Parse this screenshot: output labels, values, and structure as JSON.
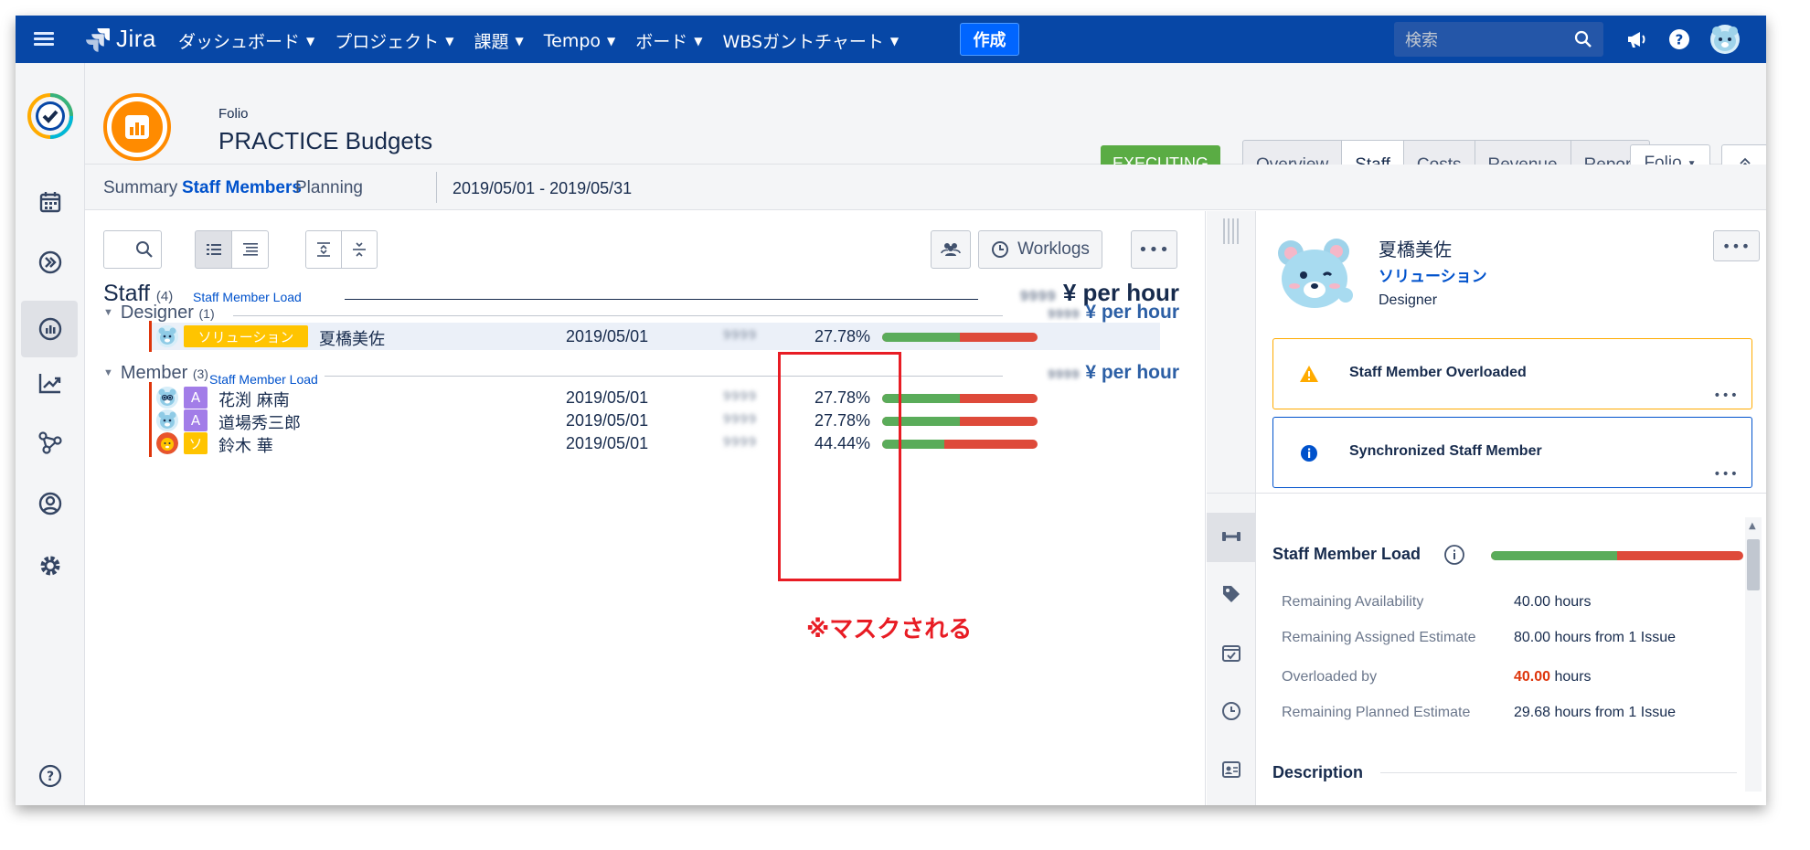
{
  "topnav": {
    "logo_text": "Jira",
    "menu": [
      {
        "label": "ダッシュボード",
        "has_dropdown": true
      },
      {
        "label": "プロジェクト",
        "has_dropdown": true
      },
      {
        "label": "課題",
        "has_dropdown": true
      },
      {
        "label": "Tempo",
        "has_dropdown": true
      },
      {
        "label": "ボード",
        "has_dropdown": true
      },
      {
        "label": "WBSガントチャート",
        "has_dropdown": true
      }
    ],
    "create_label": "作成",
    "search_placeholder": "検索",
    "icons": [
      "megaphone-icon",
      "help-icon",
      "user-avatar-icon"
    ],
    "colors": {
      "bar": "#0747a6",
      "create": "#0065ff"
    }
  },
  "sidebar": {
    "icons": [
      "app-logo-icon",
      "calendar-icon",
      "forward-icon",
      "dashboard-icon",
      "chart-icon",
      "network-icon",
      "user-circle-icon",
      "settings-icon",
      "help-icon"
    ],
    "active_index": 3
  },
  "project": {
    "parent": "Folio",
    "title": "PRACTICE Budgets",
    "status": "EXECUTING",
    "status_color": "#5aac44",
    "tabs": [
      {
        "label": "Overview",
        "active": false
      },
      {
        "label": "Staff",
        "active": true
      },
      {
        "label": "Costs",
        "active": false
      },
      {
        "label": "Revenue",
        "active": false
      },
      {
        "label": "Report",
        "active": false
      }
    ],
    "folio_dropdown": "Folio"
  },
  "subtabs": {
    "items": [
      "Summary",
      "Staff Members",
      "Planning"
    ],
    "active": "Staff Members",
    "date_range": "2019/05/01  - 2019/05/31"
  },
  "staff": {
    "title": "Staff",
    "count": "(4)",
    "load_link": "Staff Member Load",
    "rate_masked": "9999",
    "rate_unit": "¥ per hour",
    "worklogs_label": "Worklogs",
    "groups": [
      {
        "name": "Designer",
        "count": "(1)",
        "load_link": "",
        "rate_masked": "9999",
        "rate_unit": "¥ per hour",
        "members": [
          {
            "badge": "ソリューション",
            "badge_color": "#ffc400",
            "name": "夏橋美佐",
            "date": "2019/05/01",
            "masked": "9999",
            "pct": "27.78%",
            "fill": 0.5,
            "highlight": true,
            "avatar": "bear"
          }
        ]
      },
      {
        "name": "Member",
        "count": "(3)",
        "load_link": "Staff Member Load",
        "rate_masked": "9999",
        "rate_unit": "¥ per hour",
        "members": [
          {
            "badge": "A",
            "badge_color": "#a27de8",
            "name": "花渕 麻南",
            "date": "2019/05/01",
            "masked": "9999",
            "pct": "27.78%",
            "fill": 0.5,
            "highlight": false,
            "avatar": "bear-glasses"
          },
          {
            "badge": "A",
            "badge_color": "#a27de8",
            "name": "道場秀三郎",
            "date": "2019/05/01",
            "masked": "9999",
            "pct": "27.78%",
            "fill": 0.5,
            "highlight": false,
            "avatar": "bear"
          },
          {
            "badge": "ソ",
            "badge_color": "#ffc400",
            "name": "鈴木 華",
            "date": "2019/05/01",
            "masked": "9999",
            "pct": "44.44%",
            "fill": 0.4,
            "highlight": false,
            "avatar": "lion"
          }
        ]
      }
    ],
    "mask_note": "※マスクされる"
  },
  "detail": {
    "name": "夏橋美佐",
    "team": "ソリューション",
    "role": "Designer",
    "alerts": [
      {
        "title": "Staff Member Overloaded",
        "type": "warning",
        "border": "#ffab00"
      },
      {
        "title": "Synchronized Staff Member",
        "type": "info",
        "border": "#0052cc"
      }
    ],
    "load_title": "Staff Member Load",
    "load_fill": 0.5,
    "kv": [
      {
        "label": "Remaining Availability",
        "value": "40.00 hours"
      },
      {
        "label": "Remaining Assigned Estimate",
        "value": "80.00 hours from 1 Issue"
      },
      {
        "label": "Overloaded by",
        "value_red": "40.00",
        "value": " hours"
      },
      {
        "label": "Remaining Planned Estimate",
        "value": "29.68 hours from 1 Issue"
      }
    ],
    "description_title": "Description",
    "rail_icons": [
      "dumbbell-icon",
      "tag-icon",
      "calendar-check-icon",
      "clock-icon",
      "id-card-icon"
    ]
  }
}
